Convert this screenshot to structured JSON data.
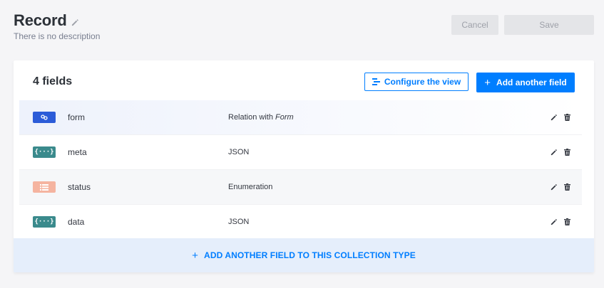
{
  "header": {
    "title": "Record",
    "subtitle": "There is no description",
    "cancel_label": "Cancel",
    "save_label": "Save"
  },
  "panel": {
    "fields_count": "4 fields",
    "configure_label": "Configure the view",
    "add_field_label": "Add another field",
    "add_collection_label": "ADD ANOTHER FIELD TO THIS COLLECTION TYPE"
  },
  "fields": [
    {
      "name": "form",
      "type_prefix": "Relation with ",
      "type_target": "Form",
      "icon": "relation-icon",
      "icon_color": "#2c5cd8"
    },
    {
      "name": "meta",
      "type_prefix": "JSON",
      "type_target": "",
      "icon": "json-icon",
      "icon_color": "#3a8a8c"
    },
    {
      "name": "status",
      "type_prefix": "Enumeration",
      "type_target": "",
      "icon": "enumeration-icon",
      "icon_color": "#f5b4a0"
    },
    {
      "name": "data",
      "type_prefix": "JSON",
      "type_target": "",
      "icon": "json-icon",
      "icon_color": "#3a8a8c"
    }
  ],
  "colors": {
    "accent": "#007eff",
    "disabled_bg": "#e4e5e8",
    "disabled_text": "#9ea1a9",
    "add_row_bg": "#e5eefb"
  },
  "icons": {
    "edit": "pencil-icon",
    "delete": "trash-icon",
    "configure": "list-settings-icon",
    "add": "plus-icon"
  }
}
